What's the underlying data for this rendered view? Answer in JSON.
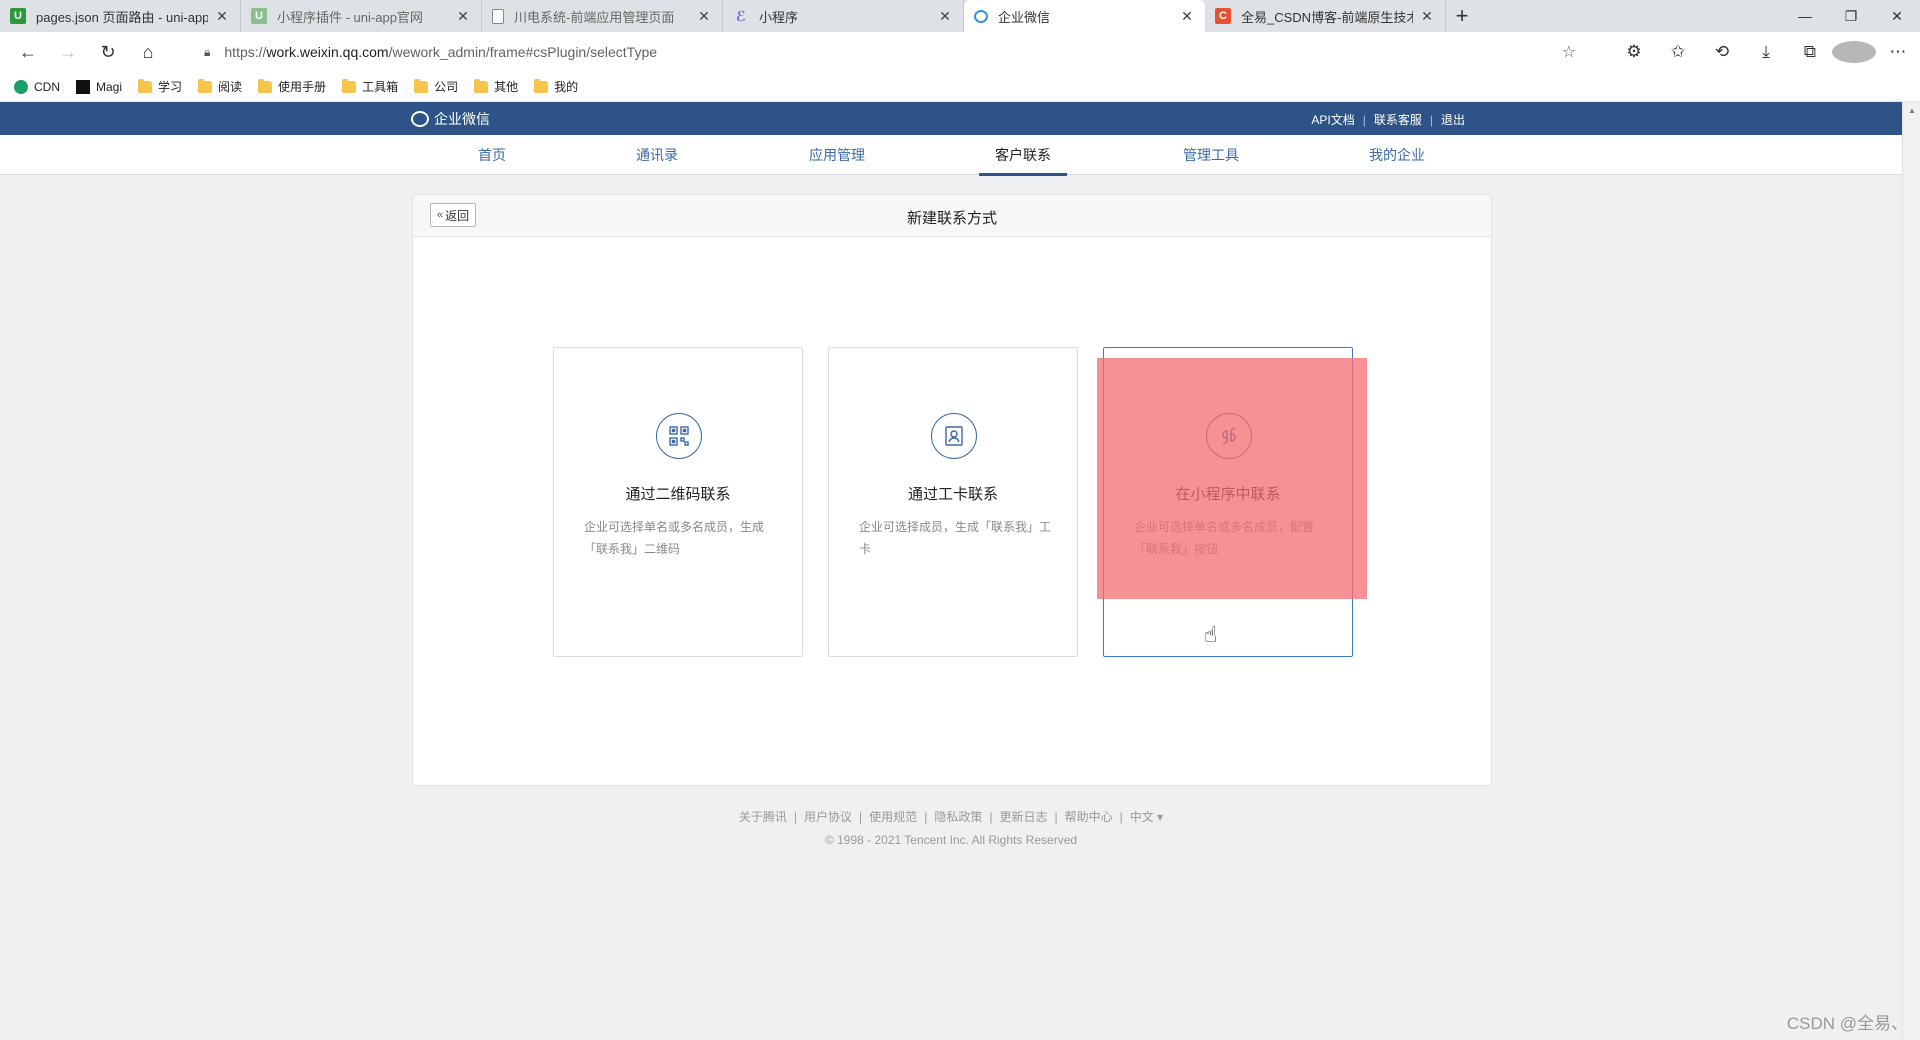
{
  "browser": {
    "tabs": [
      {
        "title": "pages.json 页面路由 - uni-app官",
        "favicon_color": "#2b9939",
        "favicon_text": "U"
      },
      {
        "title": "小程序插件 - uni-app官网",
        "favicon_color": "#8bbf8f",
        "favicon_text": "U"
      },
      {
        "title": "川电系统-前端应用管理页面",
        "favicon_color": "#ffffff",
        "favicon_text": ""
      },
      {
        "title": "小程序",
        "favicon_color": "#ffffff",
        "favicon_text": ""
      },
      {
        "title": "企业微信",
        "favicon_color": "#ffffff",
        "favicon_text": ""
      },
      {
        "title": "全易_CSDN博客-前端原生技术:",
        "favicon_color": "#e8502f",
        "favicon_text": "C"
      }
    ],
    "active_tab": 4,
    "url_prefix": "https://",
    "url_host": "work.weixin.qq.com",
    "url_path": "/wework_admin/frame#csPlugin/selectType",
    "bookmarks": [
      {
        "label": "CDN",
        "icon": "cdn-icon"
      },
      {
        "label": "Magi",
        "icon": "magi-icon"
      },
      {
        "label": "学习",
        "icon": "folder-icon"
      },
      {
        "label": "阅读",
        "icon": "folder-icon"
      },
      {
        "label": "使用手册",
        "icon": "folder-icon"
      },
      {
        "label": "工具箱",
        "icon": "folder-icon"
      },
      {
        "label": "公司",
        "icon": "folder-icon"
      },
      {
        "label": "其他",
        "icon": "folder-icon"
      },
      {
        "label": "我的",
        "icon": "folder-icon"
      }
    ]
  },
  "header": {
    "brand": "企业微信",
    "links": [
      "API文档",
      "联系客服",
      "退出"
    ]
  },
  "nav": {
    "items": [
      "首页",
      "通讯录",
      "应用管理",
      "客户联系",
      "管理工具",
      "我的企业"
    ],
    "active": 3
  },
  "panel": {
    "back_label": "返回",
    "title": "新建联系方式",
    "cards": [
      {
        "title": "通过二维码联系",
        "desc": "企业可选择单名或多名成员，生成「联系我」二维码",
        "icon": "qrcode-icon"
      },
      {
        "title": "通过工卡联系",
        "desc": "企业可选择成员，生成「联系我」工卡",
        "icon": "badge-card-icon"
      },
      {
        "title": "在小程序中联系",
        "desc": "企业可选择单名或多名成员，配置「联系我」按钮",
        "icon": "mini-program-icon"
      }
    ],
    "selected_card": 2
  },
  "footer": {
    "links": [
      "关于腾讯",
      "用户协议",
      "使用规范",
      "隐私政策",
      "更新日志",
      "帮助中心",
      "中文 ▾"
    ],
    "copyright": "© 1998 - 2021 Tencent Inc. All Rights Reserved"
  },
  "watermark": "CSDN @全易、",
  "colors": {
    "brand_bar": "#2e5386",
    "link": "#3b6aa8",
    "highlight_overlay": "#f36d72"
  }
}
